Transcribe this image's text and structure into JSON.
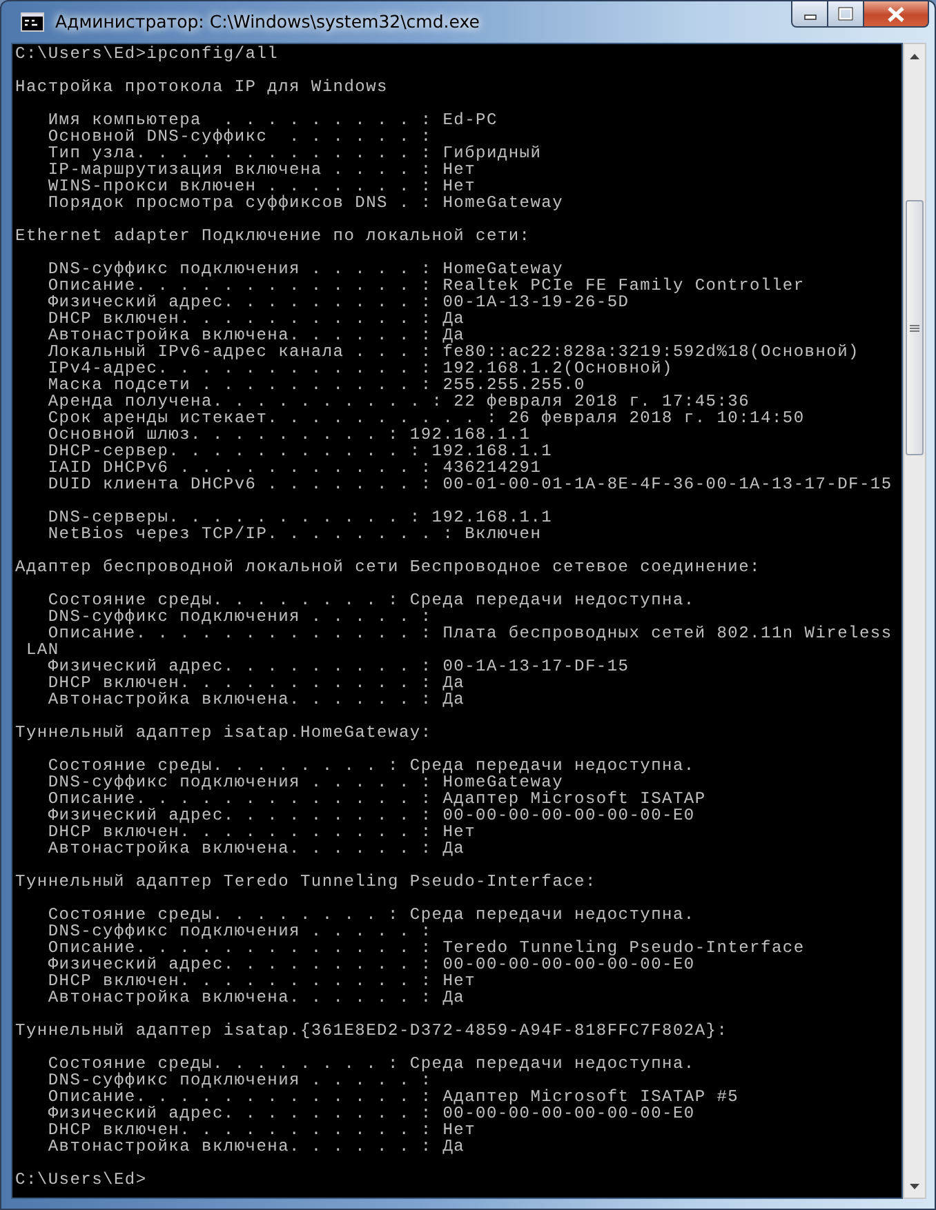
{
  "window": {
    "title": "Администратор: C:\\Windows\\system32\\cmd.exe"
  },
  "console": {
    "blocks": [
      {
        "lines": [
          "C:\\Users\\Ed>ipconfig/all"
        ]
      },
      {
        "lines": [
          "Настройка протокола IP для Windows"
        ]
      },
      {
        "lines": [
          "   Имя компьютера  . . . . . . . . . : Ed-PC",
          "   Основной DNS-суффикс  . . . . . . :",
          "   Тип узла. . . . . . . . . . . . . : Гибридный",
          "   IP-маршрутизация включена . . . . : Нет",
          "   WINS-прокси включен . . . . . . . : Нет",
          "   Порядок просмотра суффиксов DNS . : HomeGateway"
        ]
      },
      {
        "lines": [
          "Ethernet adapter Подключение по локальной сети:"
        ]
      },
      {
        "lines": [
          "   DNS-суффикс подключения . . . . . : HomeGateway",
          "   Описание. . . . . . . . . . . . . : Realtek PCIe FE Family Controller",
          "   Физический адрес. . . . . . . . . : 00-1A-13-19-26-5D",
          "   DHCP включен. . . . . . . . . . . : Да",
          "   Автонастройка включена. . . . . . : Да",
          "   Локальный IPv6-адрес канала . . . : fe80::ac22:828a:3219:592d%18(Основной)",
          "   IPv4-адрес. . . . . . . . . . . . : 192.168.1.2(Основной)",
          "   Маска подсети . . . . . . . . . . : 255.255.255.0",
          "   Аренда получена. . . . . . . . . . : 22 февраля 2018 г. 17:45:36",
          "   Срок аренды истекает. . . . . . . . . . : 26 февраля 2018 г. 10:14:50",
          "   Основной шлюз. . . . . . . . . : 192.168.1.1",
          "   DHCP-сервер. . . . . . . . . . . : 192.168.1.1",
          "   IAID DHCPv6 . . . . . . . . . . . : 436214291",
          "   DUID клиента DHCPv6 . . . . . . . : 00-01-00-01-1A-8E-4F-36-00-1A-13-17-DF-15"
        ]
      },
      {
        "lines": [
          "   DNS-серверы. . . . . . . . . . . : 192.168.1.1",
          "   NetBios через TCP/IP. . . . . . . . : Включен"
        ]
      },
      {
        "lines": [
          "Адаптер беспроводной локальной сети Беспроводное сетевое соединение:"
        ]
      },
      {
        "lines": [
          "   Состояние среды. . . . . . . . : Среда передачи недоступна.",
          "   DNS-суффикс подключения . . . . . :",
          "   Описание. . . . . . . . . . . . . : Плата беспроводных сетей 802.11n Wireless",
          " LAN",
          "   Физический адрес. . . . . . . . . : 00-1A-13-17-DF-15",
          "   DHCP включен. . . . . . . . . . . : Да",
          "   Автонастройка включена. . . . . . : Да"
        ]
      },
      {
        "lines": [
          "Туннельный адаптер isatap.HomeGateway:"
        ]
      },
      {
        "lines": [
          "   Состояние среды. . . . . . . . : Среда передачи недоступна.",
          "   DNS-суффикс подключения . . . . . : HomeGateway",
          "   Описание. . . . . . . . . . . . . : Адаптер Microsoft ISATAP",
          "   Физический адрес. . . . . . . . . : 00-00-00-00-00-00-00-E0",
          "   DHCP включен. . . . . . . . . . . : Нет",
          "   Автонастройка включена. . . . . . : Да"
        ]
      },
      {
        "lines": [
          "Туннельный адаптер Teredo Tunneling Pseudo-Interface:"
        ]
      },
      {
        "lines": [
          "   Состояние среды. . . . . . . . : Среда передачи недоступна.",
          "   DNS-суффикс подключения . . . . . :",
          "   Описание. . . . . . . . . . . . . : Teredo Tunneling Pseudo-Interface",
          "   Физический адрес. . . . . . . . . : 00-00-00-00-00-00-00-E0",
          "   DHCP включен. . . . . . . . . . . : Нет",
          "   Автонастройка включена. . . . . . : Да"
        ]
      },
      {
        "lines": [
          "Туннельный адаптер isatap.{361E8ED2-D372-4859-A94F-818FFC7F802A}:"
        ]
      },
      {
        "lines": [
          "   Состояние среды. . . . . . . . : Среда передачи недоступна.",
          "   DNS-суффикс подключения . . . . . :",
          "   Описание. . . . . . . . . . . . . : Адаптер Microsoft ISATAP #5",
          "   Физический адрес. . . . . . . . . : 00-00-00-00-00-00-00-E0",
          "   DHCP включен. . . . . . . . . . . : Нет",
          "   Автонастройка включена. . . . . . : Да"
        ]
      },
      {
        "lines": [
          "C:\\Users\\Ed>"
        ]
      }
    ]
  }
}
